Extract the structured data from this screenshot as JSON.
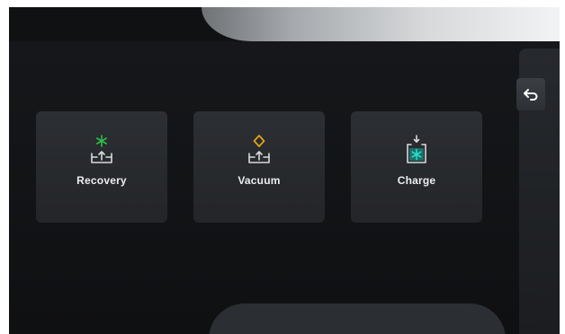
{
  "colors": {
    "background": "#121315",
    "tile": "#2a2c30",
    "label": "#eceef0",
    "icon_outline": "#d8dadc",
    "recovery_accent": "#2fbf4a",
    "vacuum_accent": "#e8a21a",
    "charge_accent": "#27c2b0"
  },
  "tiles": [
    {
      "id": "recovery",
      "label": "Recovery",
      "icon": "refrigerant-recovery-icon"
    },
    {
      "id": "vacuum",
      "label": "Vacuum",
      "icon": "vacuum-icon"
    },
    {
      "id": "charge",
      "label": "Charge",
      "icon": "refrigerant-charge-icon"
    }
  ],
  "side_panel": {
    "back_icon": "back-arrow-icon"
  }
}
